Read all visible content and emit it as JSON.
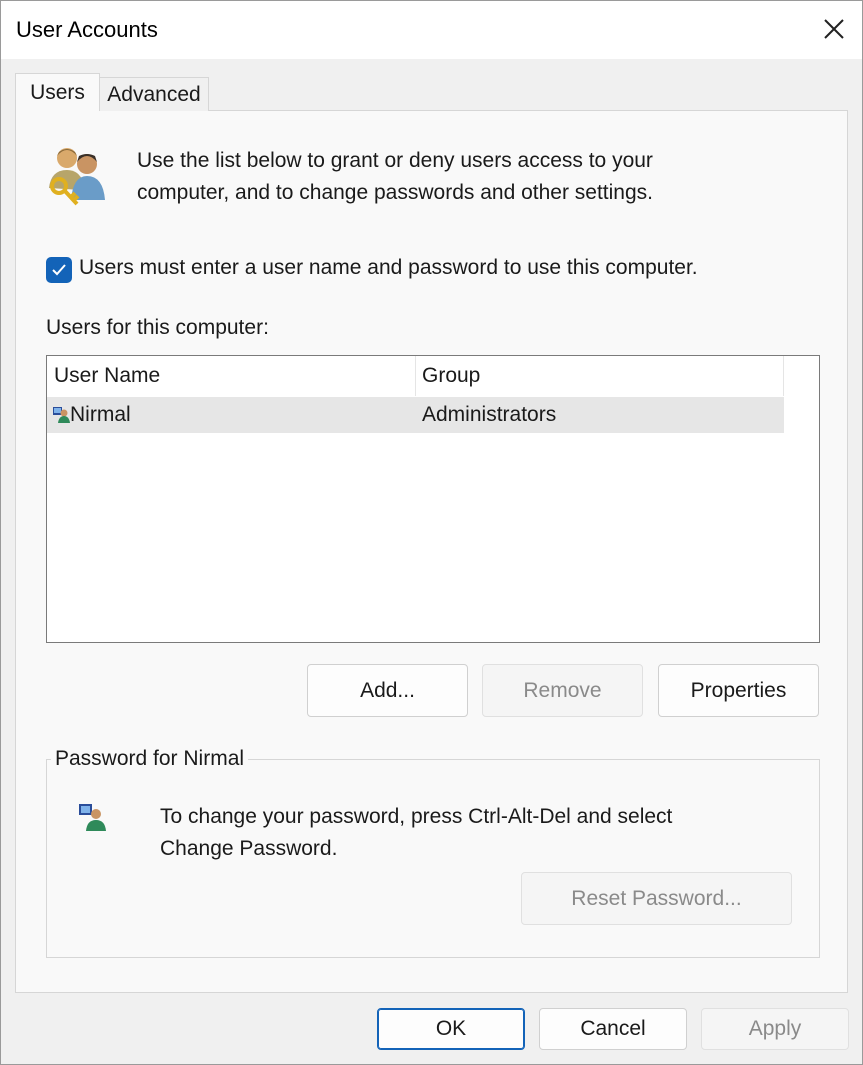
{
  "window": {
    "title": "User Accounts"
  },
  "tabs": [
    {
      "label": "Users",
      "active": true
    },
    {
      "label": "Advanced",
      "active": false
    }
  ],
  "intro": {
    "icon": "users-keys-icon",
    "line1": "Use the list below to grant or deny users access to your",
    "line2": "computer, and to change passwords and other settings."
  },
  "require_login": {
    "checked": true,
    "label": "Users must enter a user name and password to use this computer."
  },
  "users_list": {
    "label": "Users for this computer:",
    "columns": [
      "User Name",
      "Group"
    ],
    "rows": [
      {
        "name": "Nirmal",
        "group": "Administrators",
        "icon": "user-icon",
        "selected": true
      }
    ]
  },
  "list_buttons": {
    "add": "Add...",
    "remove": "Remove",
    "properties": "Properties"
  },
  "password_group": {
    "title": "Password for Nirmal",
    "line1": "To change your password, press Ctrl-Alt-Del and select",
    "line2": "Change Password.",
    "reset_button": "Reset Password..."
  },
  "footer": {
    "ok": "OK",
    "cancel": "Cancel",
    "apply": "Apply"
  },
  "colors": {
    "accent": "#1363b8",
    "selection": "#e6e6e6"
  }
}
